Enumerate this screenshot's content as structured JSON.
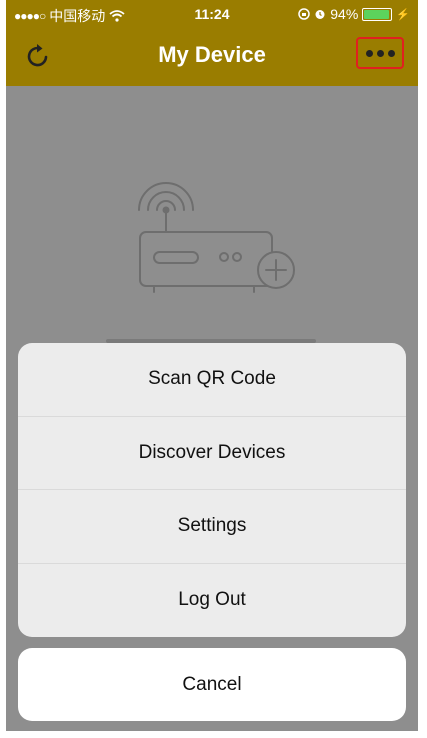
{
  "status_bar": {
    "carrier": "中国移动",
    "time": "11:24",
    "battery_percent": "94%",
    "battery_level": 0.94
  },
  "nav": {
    "title": "My Device",
    "left_icon": "refresh-icon",
    "right_icon": "more-icon"
  },
  "colors": {
    "nav_background": "#9a7d00",
    "highlight_border": "#e02020",
    "overlay": "#8e8e8e"
  },
  "action_sheet": {
    "items": [
      {
        "label": "Scan QR Code"
      },
      {
        "label": "Discover Devices"
      },
      {
        "label": "Settings"
      },
      {
        "label": "Log Out"
      }
    ],
    "cancel_label": "Cancel"
  }
}
